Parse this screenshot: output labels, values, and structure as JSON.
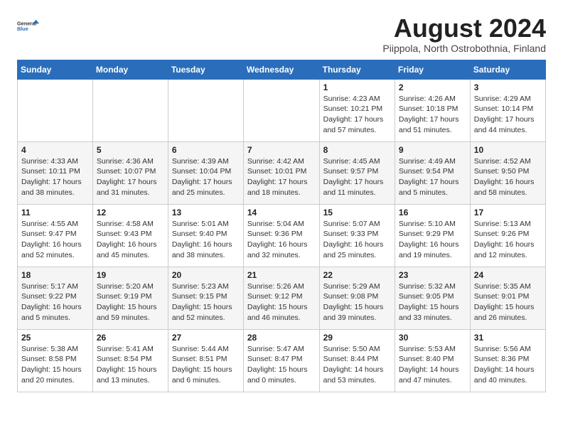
{
  "logo": {
    "general": "General",
    "blue": "Blue"
  },
  "title": "August 2024",
  "location": "Piippola, North Ostrobothnia, Finland",
  "weekdays": [
    "Sunday",
    "Monday",
    "Tuesday",
    "Wednesday",
    "Thursday",
    "Friday",
    "Saturday"
  ],
  "weeks": [
    [
      {
        "day": "",
        "info": ""
      },
      {
        "day": "",
        "info": ""
      },
      {
        "day": "",
        "info": ""
      },
      {
        "day": "",
        "info": ""
      },
      {
        "day": "1",
        "info": "Sunrise: 4:23 AM\nSunset: 10:21 PM\nDaylight: 17 hours\nand 57 minutes."
      },
      {
        "day": "2",
        "info": "Sunrise: 4:26 AM\nSunset: 10:18 PM\nDaylight: 17 hours\nand 51 minutes."
      },
      {
        "day": "3",
        "info": "Sunrise: 4:29 AM\nSunset: 10:14 PM\nDaylight: 17 hours\nand 44 minutes."
      }
    ],
    [
      {
        "day": "4",
        "info": "Sunrise: 4:33 AM\nSunset: 10:11 PM\nDaylight: 17 hours\nand 38 minutes."
      },
      {
        "day": "5",
        "info": "Sunrise: 4:36 AM\nSunset: 10:07 PM\nDaylight: 17 hours\nand 31 minutes."
      },
      {
        "day": "6",
        "info": "Sunrise: 4:39 AM\nSunset: 10:04 PM\nDaylight: 17 hours\nand 25 minutes."
      },
      {
        "day": "7",
        "info": "Sunrise: 4:42 AM\nSunset: 10:01 PM\nDaylight: 17 hours\nand 18 minutes."
      },
      {
        "day": "8",
        "info": "Sunrise: 4:45 AM\nSunset: 9:57 PM\nDaylight: 17 hours\nand 11 minutes."
      },
      {
        "day": "9",
        "info": "Sunrise: 4:49 AM\nSunset: 9:54 PM\nDaylight: 17 hours\nand 5 minutes."
      },
      {
        "day": "10",
        "info": "Sunrise: 4:52 AM\nSunset: 9:50 PM\nDaylight: 16 hours\nand 58 minutes."
      }
    ],
    [
      {
        "day": "11",
        "info": "Sunrise: 4:55 AM\nSunset: 9:47 PM\nDaylight: 16 hours\nand 52 minutes."
      },
      {
        "day": "12",
        "info": "Sunrise: 4:58 AM\nSunset: 9:43 PM\nDaylight: 16 hours\nand 45 minutes."
      },
      {
        "day": "13",
        "info": "Sunrise: 5:01 AM\nSunset: 9:40 PM\nDaylight: 16 hours\nand 38 minutes."
      },
      {
        "day": "14",
        "info": "Sunrise: 5:04 AM\nSunset: 9:36 PM\nDaylight: 16 hours\nand 32 minutes."
      },
      {
        "day": "15",
        "info": "Sunrise: 5:07 AM\nSunset: 9:33 PM\nDaylight: 16 hours\nand 25 minutes."
      },
      {
        "day": "16",
        "info": "Sunrise: 5:10 AM\nSunset: 9:29 PM\nDaylight: 16 hours\nand 19 minutes."
      },
      {
        "day": "17",
        "info": "Sunrise: 5:13 AM\nSunset: 9:26 PM\nDaylight: 16 hours\nand 12 minutes."
      }
    ],
    [
      {
        "day": "18",
        "info": "Sunrise: 5:17 AM\nSunset: 9:22 PM\nDaylight: 16 hours\nand 5 minutes."
      },
      {
        "day": "19",
        "info": "Sunrise: 5:20 AM\nSunset: 9:19 PM\nDaylight: 15 hours\nand 59 minutes."
      },
      {
        "day": "20",
        "info": "Sunrise: 5:23 AM\nSunset: 9:15 PM\nDaylight: 15 hours\nand 52 minutes."
      },
      {
        "day": "21",
        "info": "Sunrise: 5:26 AM\nSunset: 9:12 PM\nDaylight: 15 hours\nand 46 minutes."
      },
      {
        "day": "22",
        "info": "Sunrise: 5:29 AM\nSunset: 9:08 PM\nDaylight: 15 hours\nand 39 minutes."
      },
      {
        "day": "23",
        "info": "Sunrise: 5:32 AM\nSunset: 9:05 PM\nDaylight: 15 hours\nand 33 minutes."
      },
      {
        "day": "24",
        "info": "Sunrise: 5:35 AM\nSunset: 9:01 PM\nDaylight: 15 hours\nand 26 minutes."
      }
    ],
    [
      {
        "day": "25",
        "info": "Sunrise: 5:38 AM\nSunset: 8:58 PM\nDaylight: 15 hours\nand 20 minutes."
      },
      {
        "day": "26",
        "info": "Sunrise: 5:41 AM\nSunset: 8:54 PM\nDaylight: 15 hours\nand 13 minutes."
      },
      {
        "day": "27",
        "info": "Sunrise: 5:44 AM\nSunset: 8:51 PM\nDaylight: 15 hours\nand 6 minutes."
      },
      {
        "day": "28",
        "info": "Sunrise: 5:47 AM\nSunset: 8:47 PM\nDaylight: 15 hours\nand 0 minutes."
      },
      {
        "day": "29",
        "info": "Sunrise: 5:50 AM\nSunset: 8:44 PM\nDaylight: 14 hours\nand 53 minutes."
      },
      {
        "day": "30",
        "info": "Sunrise: 5:53 AM\nSunset: 8:40 PM\nDaylight: 14 hours\nand 47 minutes."
      },
      {
        "day": "31",
        "info": "Sunrise: 5:56 AM\nSunset: 8:36 PM\nDaylight: 14 hours\nand 40 minutes."
      }
    ]
  ]
}
